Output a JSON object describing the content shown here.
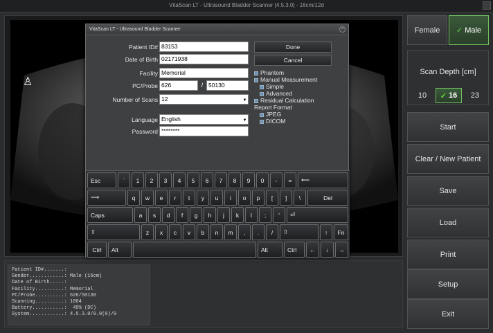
{
  "window": {
    "title": "VitaScan LT - Ultrasound Bladder Scanner [4.5.3.0] - 16cm/12d"
  },
  "viewer": {
    "body_icon": "person-icon"
  },
  "info": {
    "rows": [
      "Patient ID#.......:",
      "Gender............: Male (16cm)",
      "Date of Birth.....:",
      "Facility..........: Memorial",
      "PC/Probe..........: 626/50130",
      "Scanning..........: 1004",
      "Battery...........:  49% (DC)",
      "System............: 4.5.3.0/0.0(0)/0"
    ]
  },
  "panel": {
    "female": "Female",
    "male": "Male",
    "male_selected": true,
    "scan_depth_label": "Scan Depth [cm]",
    "depths": [
      "10",
      "16",
      "23"
    ],
    "selected_depth": "16",
    "start": "Start",
    "clear": "Clear / New Patient",
    "save": "Save",
    "load": "Load",
    "print": "Print",
    "setup": "Setup",
    "exit": "Exit"
  },
  "dialog": {
    "title": "VitaScan LT - Ultrasound Bladder Scanner",
    "labels": {
      "patient_id": "Patient ID#",
      "dob": "Date of Birth",
      "facility": "Facility",
      "pc_probe": "PC/Probe",
      "num_scans": "Number of Scans",
      "language": "Language",
      "password": "Password"
    },
    "values": {
      "patient_id": "83153",
      "dob": "02171938",
      "facility": "Memorial",
      "pc": "626",
      "probe": "50130",
      "num_scans": "12",
      "language": "English",
      "password": "********"
    },
    "slash": "/",
    "done": "Done",
    "cancel": "Cancel",
    "options": {
      "phantom": "Phantom",
      "manual": "Manual Measurement",
      "simple": "Simple",
      "advanced": "Advanced",
      "residual": "Residual Calculation",
      "report_format": "Report Format",
      "jpeg": "JPEG",
      "dicom": "DICOM"
    }
  },
  "keyboard": {
    "row1": [
      "Esc",
      "`",
      "1",
      "2",
      "3",
      "4",
      "5",
      "6",
      "7",
      "8",
      "9",
      "0",
      "-",
      "=",
      "⟵"
    ],
    "row2": [
      "⟶",
      "q",
      "w",
      "e",
      "r",
      "t",
      "y",
      "u",
      "i",
      "o",
      "p",
      "[",
      "]",
      "\\",
      "Del"
    ],
    "row3": [
      "Caps",
      "a",
      "s",
      "d",
      "f",
      "g",
      "h",
      "j",
      "k",
      "l",
      ";",
      "'",
      "⏎"
    ],
    "row4": [
      "⇧",
      "z",
      "x",
      "c",
      "v",
      "b",
      "n",
      "m",
      ",",
      ".",
      "/",
      "⇧",
      "↑",
      "Fn"
    ],
    "row5": [
      "Ctrl",
      "Alt",
      "",
      "Alt",
      "Ctrl",
      "←",
      "↓",
      "→"
    ]
  },
  "colors": {
    "accent_green": "#64d83f",
    "background": "#2b2d2e"
  }
}
